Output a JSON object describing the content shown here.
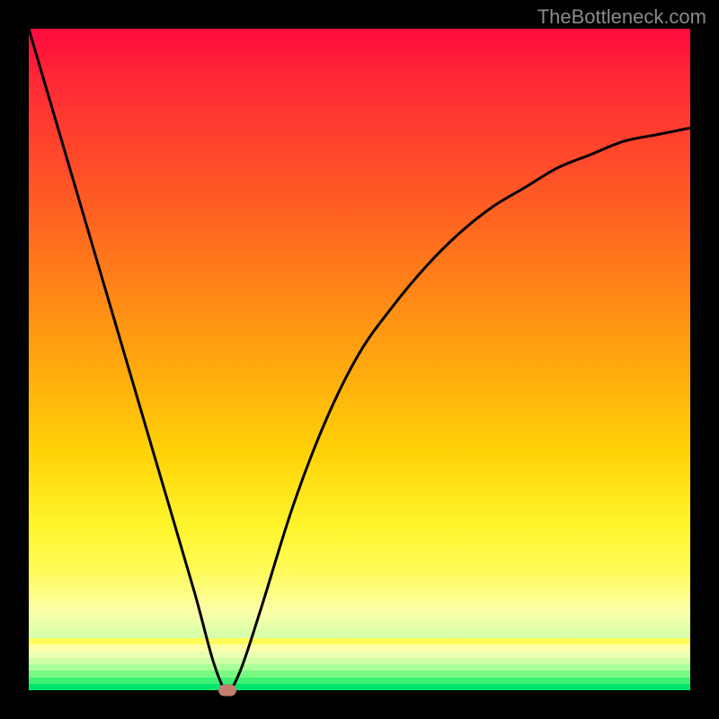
{
  "watermark": "TheBottleneck.com",
  "chart_data": {
    "type": "line",
    "title": "",
    "xlabel": "",
    "ylabel": "",
    "xlim": [
      0,
      100
    ],
    "ylim": [
      0,
      100
    ],
    "grid": false,
    "legend": false,
    "series": [
      {
        "name": "curve",
        "x": [
          0,
          5,
          10,
          15,
          20,
          25,
          28,
          30,
          32,
          35,
          40,
          45,
          50,
          55,
          60,
          65,
          70,
          75,
          80,
          85,
          90,
          95,
          100
        ],
        "y": [
          100,
          83,
          66,
          49,
          32,
          15,
          4,
          0,
          3,
          12,
          28,
          41,
          51,
          58,
          64,
          69,
          73,
          76,
          79,
          81,
          83,
          84,
          85
        ]
      }
    ],
    "marker": {
      "x": 30,
      "y": 0,
      "color": "#c17e71"
    },
    "background_gradient": {
      "type": "vertical",
      "stops": [
        {
          "pos": 0.0,
          "color": "#ff0a3e"
        },
        {
          "pos": 0.5,
          "color": "#ffa50e"
        },
        {
          "pos": 0.75,
          "color": "#fff52b"
        },
        {
          "pos": 1.0,
          "color": "#00e66b"
        }
      ]
    }
  }
}
